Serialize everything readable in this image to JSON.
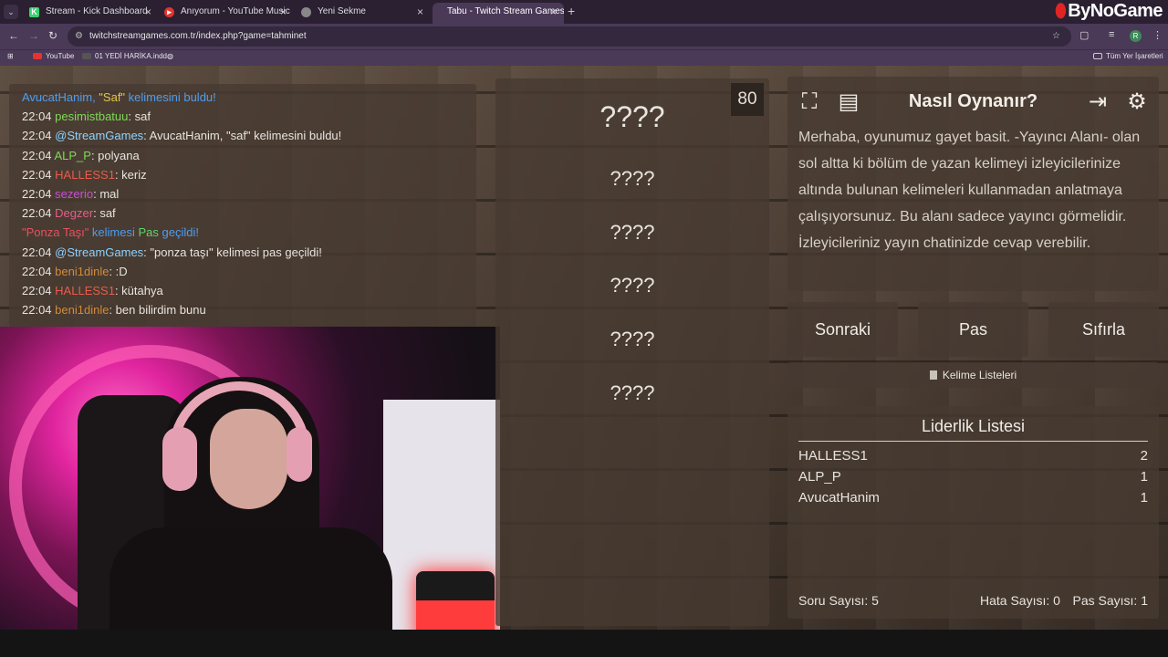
{
  "browser": {
    "tabs": [
      {
        "title": "Stream - Kick Dashboard",
        "icon": "kick-icon",
        "color": "#3bd16f"
      },
      {
        "title": "Anıyorum - YouTube Music",
        "icon": "youtube-music-icon",
        "color": "#e3342f"
      },
      {
        "title": "Yeni Sekme",
        "icon": "chrome-icon",
        "color": "#888888"
      },
      {
        "title": "Tabu - Twitch Stream Games",
        "icon": "",
        "color": ""
      }
    ],
    "url": "twitchstreamgames.com.tr/index.php?game=tahminet",
    "bookmarks": [
      "YouTube",
      "01 YEDİ HARİKA.indd"
    ],
    "all_bookmarks": "Tüm Yer İşaretleri",
    "brand": "ByNoGame",
    "avatar_letter": "R"
  },
  "chat": {
    "messages": [
      {
        "system": true,
        "parts": [
          {
            "text": "AvucatHanim, ",
            "color": "#4f9cf0"
          },
          {
            "text": "\"Saf\"",
            "color": "#e7c54a"
          },
          {
            "text": " kelimesini buldu!",
            "color": "#4f9cf0"
          }
        ]
      },
      {
        "time": "22:04",
        "user": "pesimistbatuu",
        "color": "#7ed957",
        "text": ": saf"
      },
      {
        "time": "22:04",
        "user": "@StreamGames",
        "color": "#8fd3ff",
        "text": ": AvucatHanim, \"saf\" kelimesini buldu!"
      },
      {
        "time": "22:04",
        "user": "ALP_P",
        "color": "#7ed957",
        "text": ": polyana"
      },
      {
        "time": "22:04",
        "user": "HALLESS1",
        "color": "#e85c4a",
        "text": ": keriz"
      },
      {
        "time": "22:04",
        "user": "sezerio",
        "color": "#c84fd8",
        "text": ": mal"
      },
      {
        "time": "22:04",
        "user": "Degzer",
        "color": "#e85c8a",
        "text": ": saf"
      },
      {
        "system": true,
        "parts": [
          {
            "text": "\"Ponza Taşı\"",
            "color": "#e8505f"
          },
          {
            "text": " kelimesi ",
            "color": "#4f9cf0"
          },
          {
            "text": "Pas",
            "color": "#5fd36a"
          },
          {
            "text": " geçildi!",
            "color": "#4f9cf0"
          }
        ]
      },
      {
        "time": "22:04",
        "user": "@StreamGames",
        "color": "#8fd3ff",
        "text": ": \"ponza taşı\" kelimesi pas geçildi!"
      },
      {
        "time": "22:04",
        "user": "beni1dinle",
        "color": "#d28b3a",
        "text": ": :D"
      },
      {
        "time": "22:04",
        "user": "HALLESS1",
        "color": "#e85c4a",
        "text": ": kütahya"
      },
      {
        "time": "22:04",
        "user": "beni1dinle",
        "color": "#d28b3a",
        "text": ": ben bilirdim bunu"
      }
    ]
  },
  "game": {
    "timer": "80",
    "main_word": "????",
    "taboo_words": [
      "????",
      "????",
      "????",
      "????",
      "????"
    ]
  },
  "help": {
    "title": "Nasıl Oynanır?",
    "text": "Merhaba, oyunumuz gayet basit. -Yayıncı Alanı- olan sol altta ki bölüm de yazan kelimeyi izleyicilerinize altında bulunan kelimeleri kullanmadan anlatmaya çalışıyorsunuz. Bu alanı sadece yayıncı görmelidir. İzleyicileriniz yayın chatinizde cevap verebilir."
  },
  "controls": {
    "next": "Sonraki",
    "pass": "Pas",
    "reset": "Sıfırla",
    "word_lists": "Kelime Listeleri"
  },
  "leaderboard": {
    "title": "Liderlik Listesi",
    "rows": [
      {
        "name": "HALLESS1",
        "score": "2"
      },
      {
        "name": "ALP_P",
        "score": "1"
      },
      {
        "name": "AvucatHanim",
        "score": "1"
      }
    ],
    "question_count": "Soru Sayısı: 5",
    "error_count": "Hata Sayısı: 0",
    "pass_count": "Pas Sayısı: 1"
  }
}
